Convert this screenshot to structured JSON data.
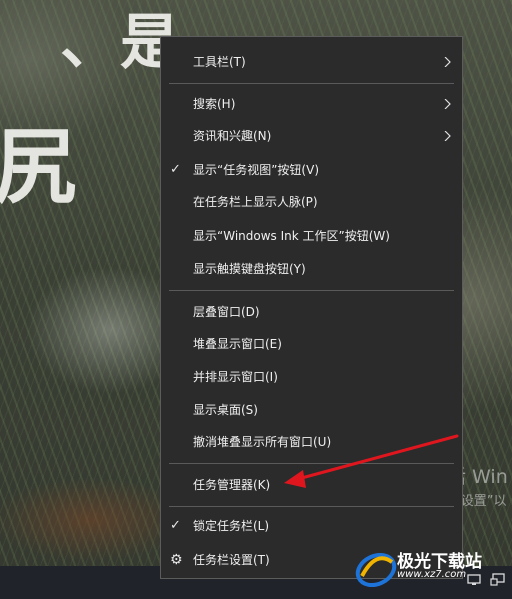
{
  "wallpaper": {
    "chars": [
      "、是",
      "尻"
    ]
  },
  "menu": {
    "items": [
      {
        "label": "工具栏(T)",
        "submenu": true
      },
      {
        "label": "搜索(H)",
        "submenu": true
      },
      {
        "label": "资讯和兴趣(N)",
        "submenu": true
      },
      {
        "label": "显示“任务视图”按钮(V)",
        "checked": true
      },
      {
        "label": "在任务栏上显示人脉(P)"
      },
      {
        "label": "显示“Windows Ink 工作区”按钮(W)"
      },
      {
        "label": "显示触摸键盘按钮(Y)"
      },
      {
        "label": "层叠窗口(D)"
      },
      {
        "label": "堆叠显示窗口(E)"
      },
      {
        "label": "并排显示窗口(I)"
      },
      {
        "label": "显示桌面(S)"
      },
      {
        "label": "撤消堆叠显示所有窗口(U)"
      },
      {
        "label": "任务管理器(K)",
        "highlighted_by_annotation": true
      },
      {
        "label": "锁定任务栏(L)",
        "checked": true
      },
      {
        "label": "任务栏设置(T)",
        "icon": "gear-icon"
      }
    ],
    "check_glyph": "✓",
    "gear_glyph": "⚙"
  },
  "activation_watermark": {
    "line1": "激活 Win",
    "line2": "转到“设置”以"
  },
  "site_logo": {
    "name": "极光下载站",
    "url": "www.xz7.com"
  },
  "colors": {
    "menu_bg": "#2b2b2b",
    "menu_text": "#f0f0f0",
    "annotation_arrow": "#e0161e"
  }
}
